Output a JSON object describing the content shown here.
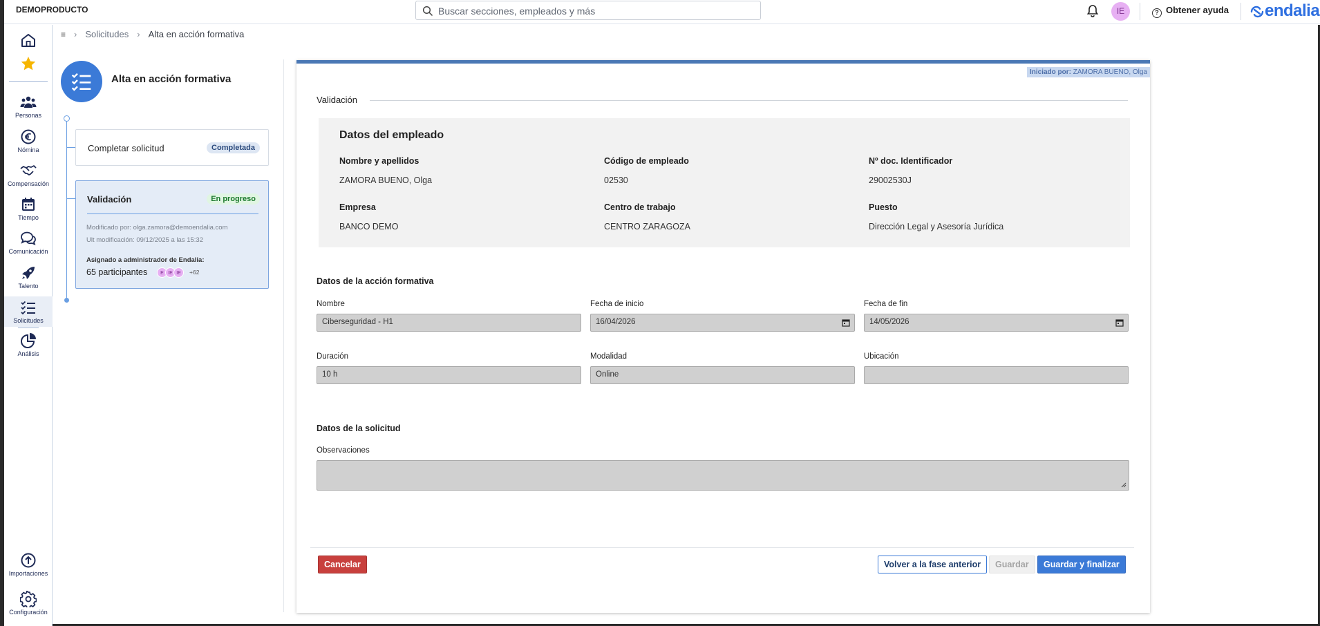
{
  "topbar": {
    "brand": "DEMOPRODUCTO",
    "search_placeholder": "Buscar secciones, empleados y más",
    "avatar_initials": "IE",
    "help_label": "Obtener ayuda",
    "logo_text": "endalia",
    "icons": [
      "search-icon",
      "bell-icon",
      "help-icon"
    ]
  },
  "sidebar": {
    "items": [
      {
        "label": "",
        "icon": "home-icon"
      },
      {
        "label": "",
        "icon": "star-icon"
      },
      {
        "label": "Personas",
        "icon": "people-icon"
      },
      {
        "label": "Nómina",
        "icon": "euro-icon"
      },
      {
        "label": "Compensación",
        "icon": "handshake-icon"
      },
      {
        "label": "Tiempo",
        "icon": "calendar-icon"
      },
      {
        "label": "Comunicación",
        "icon": "chat-icon"
      },
      {
        "label": "Talento",
        "icon": "rocket-icon"
      },
      {
        "label": "Solicitudes",
        "icon": "checklist-icon",
        "active": true
      },
      {
        "label": "Análisis",
        "icon": "pie-chart-icon"
      },
      {
        "label": "Importaciones",
        "icon": "upload-icon"
      },
      {
        "label": "Configuración",
        "icon": "gear-icon"
      }
    ]
  },
  "breadcrumb": {
    "items": [
      "Solicitudes",
      "Alta en acción formativa"
    ]
  },
  "process": {
    "title": "Alta en acción formativa",
    "steps": [
      {
        "title": "Completar solicitud",
        "status": "Completada"
      },
      {
        "title": "Validación",
        "status": "En progreso",
        "modified_by": "Modificado por: olga.zamora@demoendalia.com",
        "last_modified": "Ult modificación: 09/12/2025 a las 15:32",
        "assigned_label": "Asignado a administrador de Endalia:",
        "participants": "65 participantes",
        "avatars": [
          "E",
          "IE",
          "IE"
        ],
        "more": "+62"
      }
    ]
  },
  "card": {
    "initiated_label": "Iniciado por:",
    "initiated_by": "ZAMORA BUENO, Olga",
    "section_title": "Validación",
    "employee": {
      "title": "Datos del empleado",
      "fields": [
        {
          "label": "Nombre y apellidos",
          "value": "ZAMORA BUENO, Olga"
        },
        {
          "label": "Código de empleado",
          "value": "02530"
        },
        {
          "label": "Nº doc. Identificador",
          "value": "29002530J"
        },
        {
          "label": "Empresa",
          "value": "BANCO DEMO"
        },
        {
          "label": "Centro de trabajo",
          "value": "CENTRO ZARAGOZA"
        },
        {
          "label": "Puesto",
          "value": "Dirección Legal y Asesoría Jurídica"
        }
      ]
    },
    "training": {
      "title": "Datos de la acción formativa",
      "fields": [
        {
          "label": "Nombre",
          "value": "Ciberseguridad - H1"
        },
        {
          "label": "Fecha de inicio",
          "value": "16/04/2026"
        },
        {
          "label": "Fecha de fin",
          "value": "14/05/2026"
        },
        {
          "label": "Duración",
          "value": "10 h"
        },
        {
          "label": "Modalidad",
          "value": "Online"
        },
        {
          "label": "Ubicación",
          "value": ""
        }
      ]
    },
    "request": {
      "title": "Datos de la solicitud",
      "obs_label": "Observaciones",
      "obs_value": ""
    },
    "buttons": {
      "cancel": "Cancelar",
      "back": "Volver a la fase anterior",
      "save": "Guardar",
      "finish": "Guardar y finalizar"
    }
  },
  "colors": {
    "accent": "#3b7ad7",
    "danger": "#c8403d",
    "card_top": "#4a78b5",
    "badge_done_bg": "#dde6f3",
    "badge_progress_bg": "#e0f5e2",
    "badge_progress_text": "#1d7a2e"
  }
}
